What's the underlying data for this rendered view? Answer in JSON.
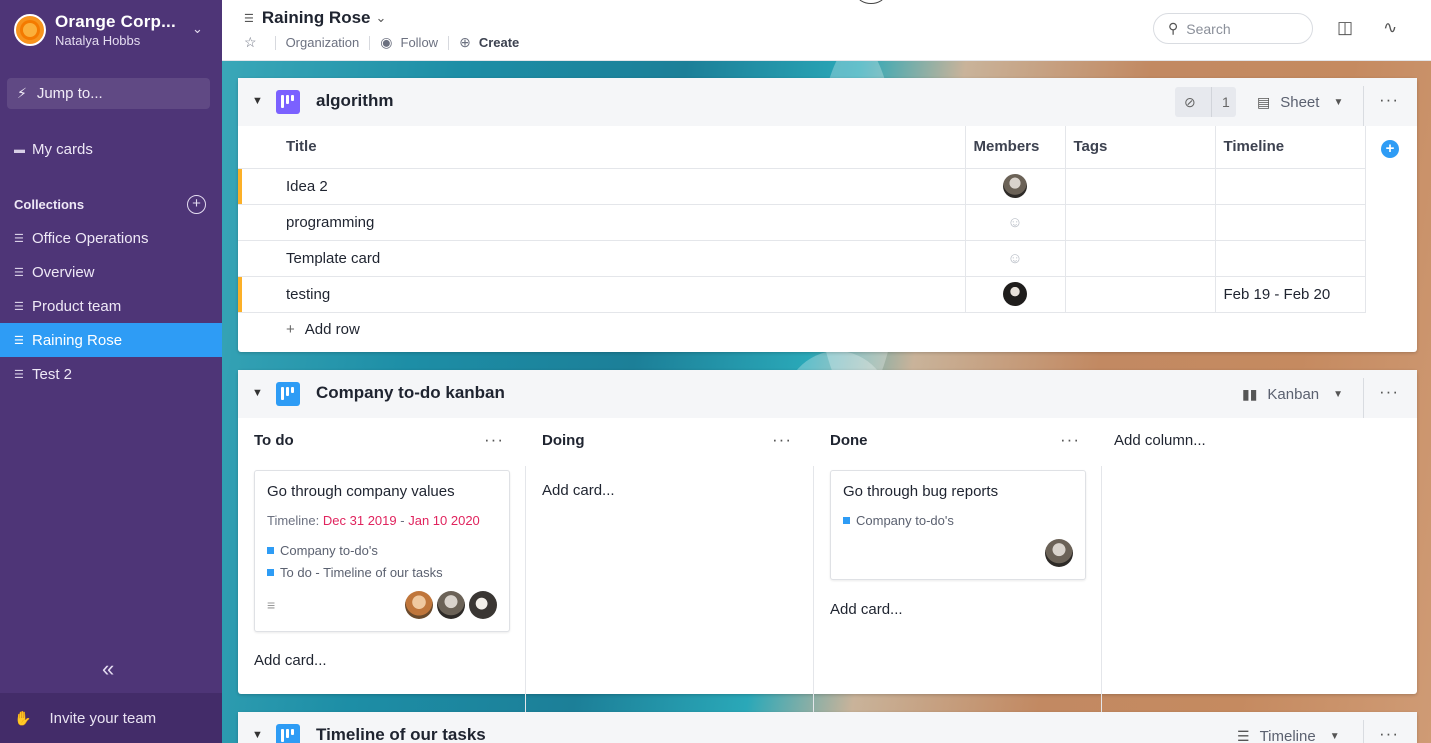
{
  "sidebar": {
    "org_name": "Orange Corp...",
    "user_name": "Natalya Hobbs",
    "jump_label": "Jump to...",
    "my_cards_label": "My cards",
    "collections_label": "Collections",
    "collections": [
      {
        "label": "Office Operations"
      },
      {
        "label": "Overview"
      },
      {
        "label": "Product team"
      },
      {
        "label": "Raining Rose"
      },
      {
        "label": "Test 2"
      }
    ],
    "active_collection": "Raining Rose",
    "invite_label": "Invite your team"
  },
  "topbar": {
    "title": "Raining Rose",
    "organization_label": "Organization",
    "follow_label": "Follow",
    "create_label": "Create",
    "search_placeholder": "Search"
  },
  "sheet_section": {
    "name": "algorithm",
    "hidden_count": "1",
    "view_label": "Sheet",
    "columns": [
      "Title",
      "Members",
      "Tags",
      "Timeline"
    ],
    "rows": [
      {
        "title": "Idea 2",
        "timeline": "",
        "member": "photo",
        "flag": true
      },
      {
        "title": "programming",
        "timeline": "",
        "member": "none",
        "flag": false
      },
      {
        "title": "Template card",
        "timeline": "",
        "member": "none",
        "flag": false
      },
      {
        "title": "testing",
        "timeline": "Feb 19 - Feb 20",
        "member": "photo-dark",
        "flag": true
      }
    ],
    "add_row_label": "Add row"
  },
  "kanban_section": {
    "name": "Company to-do kanban",
    "view_label": "Kanban",
    "columns": [
      {
        "label": "To do"
      },
      {
        "label": "Doing"
      },
      {
        "label": "Done"
      }
    ],
    "add_column_label": "Add column...",
    "add_card_label": "Add card...",
    "todo_card": {
      "title": "Go through company values",
      "timeline_label": "Timeline:",
      "timeline_start": "Dec 31 2019",
      "timeline_sep": "-",
      "timeline_end": "Jan 10 2020",
      "tags": [
        "Company to-do's",
        "To do - Timeline of our tasks"
      ]
    },
    "done_card": {
      "title": "Go through bug reports",
      "tags": [
        "Company to-do's"
      ]
    }
  },
  "timeline_section": {
    "name": "Timeline of our tasks",
    "view_label": "Timeline"
  },
  "colors": {
    "sidebar_bg": "#4e3577",
    "active_item": "#2e9cf5",
    "accent_red": "#e0245e",
    "row_flag": "#fcb028"
  }
}
